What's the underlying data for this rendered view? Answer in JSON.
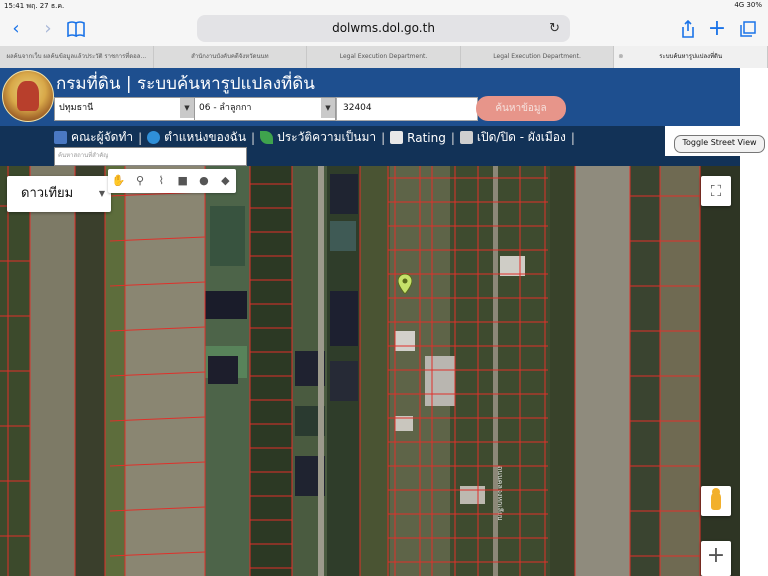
{
  "status_bar": {
    "time_date": "15:41  พฤ. 27 ธ.ค.",
    "right": "4G 30%"
  },
  "browser": {
    "url": "dolwms.dol.go.th",
    "icons": [
      "back-icon",
      "forward-icon",
      "bookmarks-icon",
      "reload-icon",
      "share-icon",
      "new-tab-icon",
      "tabs-icon"
    ]
  },
  "tabs": [
    {
      "label": "ผลค้นจากเว็บ ผลค้นข้อมูลแล้วประวัติ ราชการที่ดอล..."
    },
    {
      "label": "สำนักงานบังคับคดีจังหวัดนนท"
    },
    {
      "label": "Legal Execution Department."
    },
    {
      "label": "Legal Execution Department."
    },
    {
      "label": "ระบบค้นหารูปแปลงที่ดิน",
      "active": true
    }
  ],
  "header": {
    "title": "กรมที่ดิน | ระบบค้นหารูปแปลงที่ดิน",
    "province": "ปทุมธานี",
    "district": "06 - ลำลูกกา",
    "parcel_value": "32404",
    "search_button": "ค้นหาข้อมูล"
  },
  "menu": {
    "items": [
      {
        "label": "คณะผู้จัดทำ",
        "icon": "team-icon",
        "color": "#4a78c2"
      },
      {
        "label": "ตำแหน่งของฉัน",
        "icon": "globe-icon",
        "color": "#2f8fd8"
      },
      {
        "label": "ประวัติความเป็นมา",
        "icon": "leaf-icon",
        "color": "#3fa34d"
      },
      {
        "label": "Rating",
        "icon": "chart-icon",
        "color": "#e8e8e8"
      },
      {
        "label": "เปิด/ปิด - ผังเมือง",
        "icon": "toggle-icon",
        "color": "#cfcfcf"
      }
    ],
    "place_search_placeholder": "ค้นหาสถานที่สำคัญ"
  },
  "street_view_button": "Toggle Street View",
  "map": {
    "type_label": "ดาวเทียม",
    "road_label": "ถนนคลองหกเลียบ",
    "tools": [
      "hand-icon",
      "marker-icon",
      "polyline-icon",
      "rectangle-icon",
      "circle-icon",
      "polygon-icon"
    ],
    "parcel_line_color": "#e0302a"
  }
}
